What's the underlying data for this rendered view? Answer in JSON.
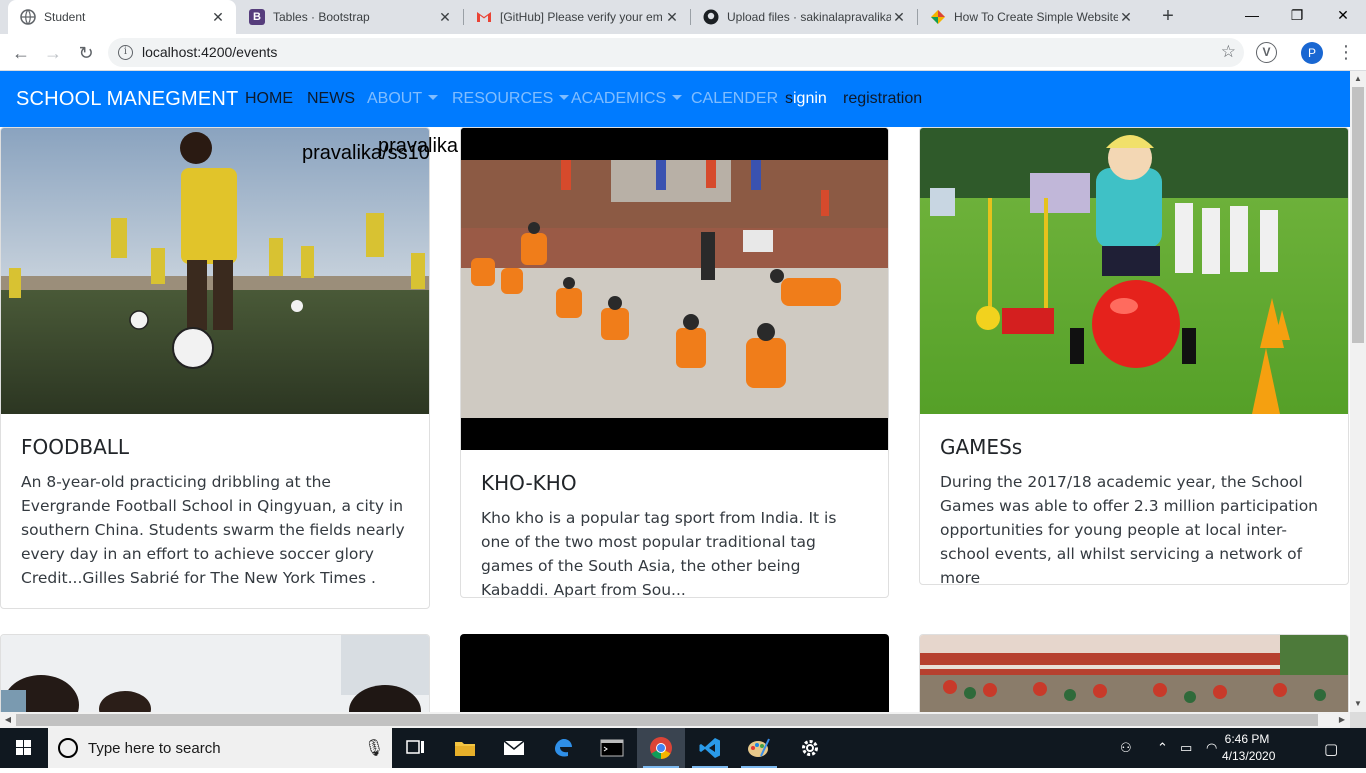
{
  "browser": {
    "tabs": [
      {
        "title": "Student",
        "active": true,
        "favicon": "globe-icon"
      },
      {
        "title": "Tables · Bootstrap",
        "active": false,
        "favicon": "bootstrap-icon"
      },
      {
        "title": "[GitHub] Please verify your em",
        "active": false,
        "favicon": "gmail-icon"
      },
      {
        "title": "Upload files · sakinalapravalika",
        "active": false,
        "favicon": "github-icon"
      },
      {
        "title": "How To Create Simple Website",
        "active": false,
        "favicon": "multicolor-icon"
      }
    ],
    "new_tab": "+",
    "url": "localhost:4200/events",
    "profile_initial": "P",
    "extension_letter": "V"
  },
  "navbar": {
    "brand": "SCHOOL MANEGMENT",
    "links": {
      "home": "HOME",
      "news": "NEWS",
      "about": "ABOUT",
      "resources": "RESOURCES",
      "academics": "ACADEMICS",
      "calender": "CALENDER",
      "signin_pre": "s",
      "signin_post": "ignin",
      "registration": "registration"
    },
    "color": "#007bff"
  },
  "overlays": {
    "text_a": "pravalika/ss10",
    "text_b": "pravalika"
  },
  "cards": [
    {
      "title": "FOODBALL",
      "text": "An 8-year-old practicing dribbling at the Evergrande Football School in Qingyuan, a city in southern China. Students swarm the fields nearly every day in an effort to achieve soccer glory Credit...Gilles Sabrié for The New York Times ."
    },
    {
      "title": "KHO-KHO",
      "text": "Kho kho is a popular tag sport from India. It is one of the two most popular traditional tag games of the South Asia, the other being Kabaddi. Apart from Sou..."
    },
    {
      "title": "GAMESs",
      "text": "During the 2017/18 academic year, the School Games was able to offer 2.3 million participation opportunities for young people at local inter-school events, all whilst servicing a network of more"
    }
  ],
  "taskbar": {
    "search_placeholder": "Type here to search",
    "time": "6:46 PM",
    "date": "4/13/2020"
  }
}
